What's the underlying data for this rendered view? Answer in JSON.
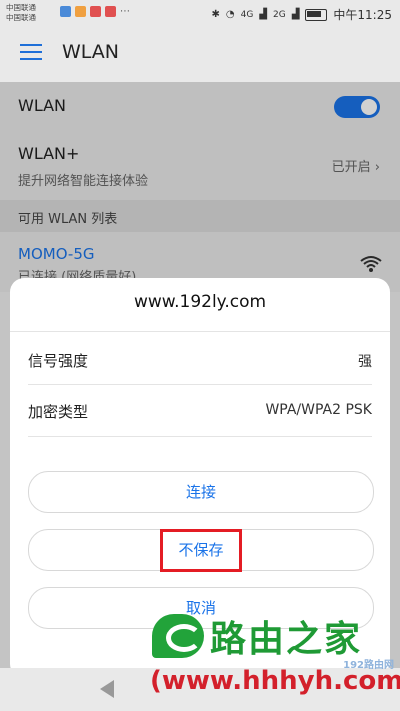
{
  "status_bar": {
    "carrier_1": "中国联通",
    "carrier_2": "中国联通",
    "signal_1": "4G",
    "signal_2": "2G",
    "time": "中午11:25"
  },
  "app_bar": {
    "title": "WLAN"
  },
  "wlan_toggle": {
    "label": "WLAN",
    "enabled": true
  },
  "wlan_plus": {
    "title": "WLAN+",
    "subtitle": "提升网络智能连接体验",
    "status": "已开启"
  },
  "section": {
    "header": "可用 WLAN 列表"
  },
  "network": {
    "name": "MOMO-5G",
    "status": "已连接 (网络质量好)"
  },
  "dialog": {
    "title": "www.192ly.com",
    "rows": [
      {
        "label": "信号强度",
        "value": "强"
      },
      {
        "label": "加密类型",
        "value": "WPA/WPA2 PSK"
      }
    ],
    "buttons": {
      "connect": "连接",
      "forget": "不保存",
      "cancel": "取消"
    }
  },
  "watermark": {
    "brand": "路由之家",
    "url": "(www.hhhyh.com",
    "site_tag": "192路由网"
  },
  "colors": {
    "accent": "#1a73e8",
    "highlight": "#e41c24",
    "brand_green": "#1f9a35",
    "brand_red": "#d3202b"
  }
}
